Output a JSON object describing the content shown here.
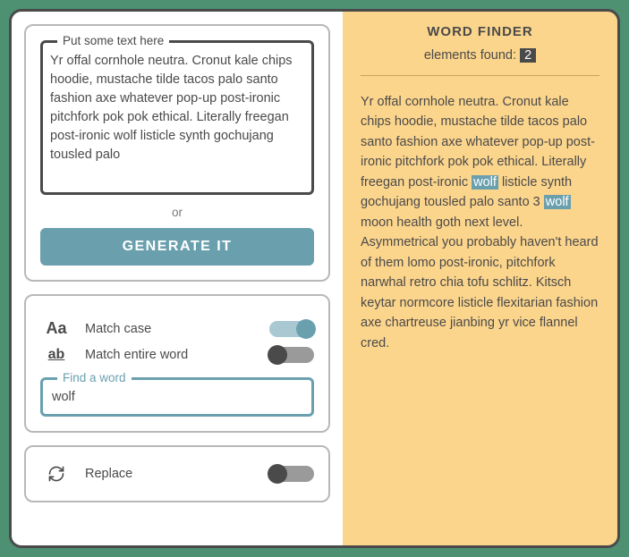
{
  "left": {
    "text_legend": "Put some text here",
    "text_value": "Yr offal cornhole neutra. Cronut kale chips hoodie, mustache tilde tacos palo santo fashion axe whatever pop-up post-ironic pitchfork pok pok ethical. Literally freegan post-ironic wolf listicle synth gochujang tousled palo",
    "or": "or",
    "generate_label": "GENERATE IT",
    "match_case_label": "Match case",
    "match_entire_label": "Match entire word",
    "match_case_on": true,
    "match_entire_on": false,
    "find_legend": "Find a word",
    "find_value": "wolf",
    "replace_label": "Replace",
    "replace_on": false
  },
  "right": {
    "title": "WORD FINDER",
    "found_prefix": "elements found: ",
    "found_count": "2",
    "body_pre": "Yr offal cornhole neutra. Cronut kale chips hoodie, mustache tilde tacos palo santo fashion axe whatever pop-up post-ironic pitchfork pok pok ethical. Literally freegan post-ironic ",
    "hl1": "wolf",
    "body_mid": " listicle synth gochujang tousled palo santo 3 ",
    "hl2": "wolf",
    "body_post": " moon health goth next level. Asymmetrical you probably haven't heard of them lomo post-ironic, pitchfork narwhal retro chia tofu schlitz. Kitsch keytar normcore listicle flexitarian fashion axe chartreuse jianbing yr vice flannel cred."
  }
}
